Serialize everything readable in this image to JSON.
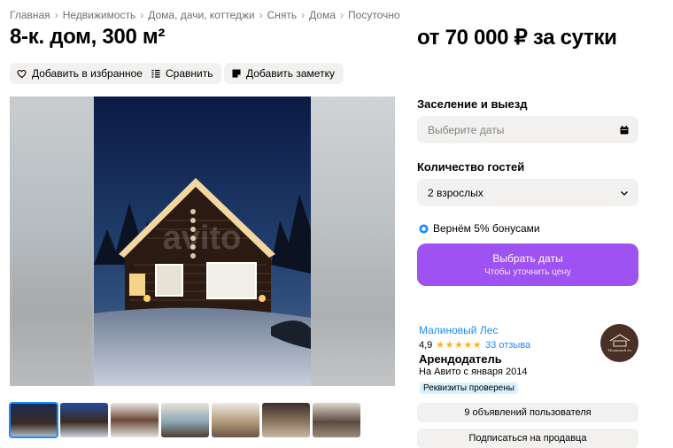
{
  "breadcrumb": [
    "Главная",
    "Недвижимость",
    "Дома, дачи, коттеджи",
    "Снять",
    "Дома",
    "Посуточно"
  ],
  "breadcrumb_separator": "›",
  "title": "8-к. дом, 300 м²",
  "price": "от 70 000 ₽ за сутки",
  "actions": {
    "favorite": "Добавить в избранное",
    "compare": "Сравнить",
    "note": "Добавить заметку"
  },
  "booking": {
    "dates_label": "Заселение и выезд",
    "dates_placeholder": "Выберите даты",
    "guests_label": "Количество гостей",
    "guests_value": "2 взрослых",
    "bonus_text": "Вернём 5% бонусами",
    "cta_main": "Выбрать даты",
    "cta_sub": "Чтобы уточнить цену"
  },
  "seller": {
    "name": "Малиновый Лес",
    "rating": "4,9",
    "stars": "★★★★★",
    "reviews": "33 отзыва",
    "role": "Арендодатель",
    "since": "На Авито с января 2014",
    "verified": "Реквизиты проверены",
    "avatar_logo": "Малиновый лес"
  },
  "buttons": {
    "listings": "9 объявлений пользователя",
    "subscribe": "Подписаться на продавца"
  },
  "gallery": {
    "watermark": "avito",
    "thumb_count": 7,
    "active_thumb": 0
  },
  "colors": {
    "accent_purple": "#9e52f2",
    "link_blue": "#1a8cff",
    "star_orange": "#ffb021",
    "chip_bg": "#f2f1f0"
  },
  "icons": {
    "favorite": "heart-icon",
    "compare": "compare-list-icon",
    "note": "note-icon",
    "calendar": "calendar-icon",
    "chevron": "chevron-down-icon",
    "bonus": "bonus-badge-icon"
  }
}
